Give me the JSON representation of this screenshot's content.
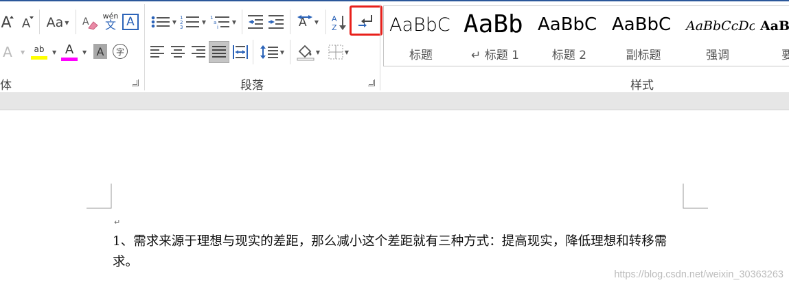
{
  "ribbon": {
    "font_group": {
      "label": "体",
      "grow_glyph": "A",
      "shrink_glyph": "A",
      "change_case_glyph": "Aa",
      "phonetic_top": "wén",
      "phonetic_bottom": "文",
      "char_border_glyph": "A",
      "text_effects_glyph": "A",
      "highlight_glyph": "ab",
      "font_color_glyph": "A",
      "char_shading_glyph": "A",
      "enclose_glyph": "字",
      "colors": {
        "highlight": "#ffff00",
        "font": "#ff00ff"
      }
    },
    "paragraph_group": {
      "label": "段落"
    },
    "styles_group": {
      "label": "样式",
      "items": [
        {
          "sample": "AaBbC",
          "name": "标题"
        },
        {
          "sample": "AaBb",
          "name": "↵ 标题 1"
        },
        {
          "sample": "AaBbC",
          "name": "标题 2"
        },
        {
          "sample": "AaBbC",
          "name": "副标题"
        },
        {
          "sample": "AaBbCcDc",
          "name": "强调"
        },
        {
          "sample": "AaB",
          "name": "要"
        }
      ]
    },
    "highlight_color": "#e8201b"
  },
  "document": {
    "paragraph_mark": "↵",
    "text": "1、需求来源于理想与现实的差距，那么减小这个差距就有三种方式：提高现实，降低理想和转移需求。"
  },
  "watermark": "https://blog.csdn.net/weixin_30363263"
}
